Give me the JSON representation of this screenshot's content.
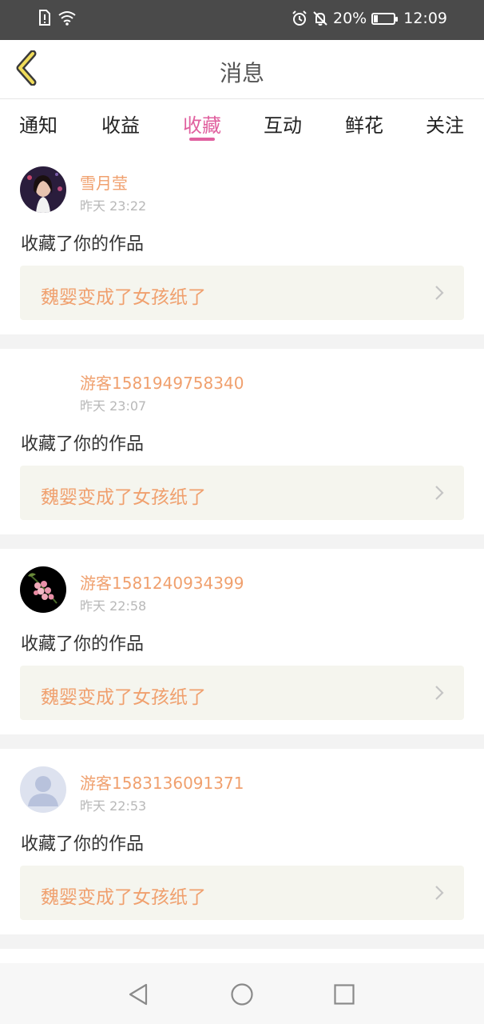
{
  "status_bar": {
    "battery_percent": "20%",
    "battery_level": 0.2,
    "time": "12:09",
    "icons": [
      "sim-alert-icon",
      "wifi-icon",
      "alarm-icon",
      "mute-bell-icon",
      "battery-charging-icon"
    ]
  },
  "header": {
    "title": "消息",
    "back_icon": "chevron-left-icon"
  },
  "tabs": [
    {
      "label": "通知",
      "active": false
    },
    {
      "label": "收益",
      "active": false
    },
    {
      "label": "收藏",
      "active": true
    },
    {
      "label": "互动",
      "active": false
    },
    {
      "label": "鲜花",
      "active": false
    },
    {
      "label": "关注",
      "active": false
    }
  ],
  "messages": [
    {
      "username": "雪月莹",
      "time": "昨天 23:22",
      "action": "收藏了你的作品",
      "work_title": "魏婴变成了女孩纸了",
      "avatar": "portrait-photo"
    },
    {
      "username": "游客1581949758340",
      "time": "昨天 23:07",
      "action": "收藏了你的作品",
      "work_title": "魏婴变成了女孩纸了",
      "avatar": "none"
    },
    {
      "username": "游客1581240934399",
      "time": "昨天 22:58",
      "action": "收藏了你的作品",
      "work_title": "魏婴变成了女孩纸了",
      "avatar": "flower-photo"
    },
    {
      "username": "游客1583136091371",
      "time": "昨天 22:53",
      "action": "收藏了你的作品",
      "work_title": "魏婴变成了女孩纸了",
      "avatar": "default-user"
    }
  ],
  "colors": {
    "accent_pink": "#e0609f",
    "username_orange": "#f0a06e",
    "status_bar_bg": "#4a4a4a",
    "work_box_bg": "#f5f5ee"
  },
  "nav_bar": {
    "icons": [
      "back-triangle-icon",
      "home-circle-icon",
      "recents-square-icon"
    ]
  }
}
